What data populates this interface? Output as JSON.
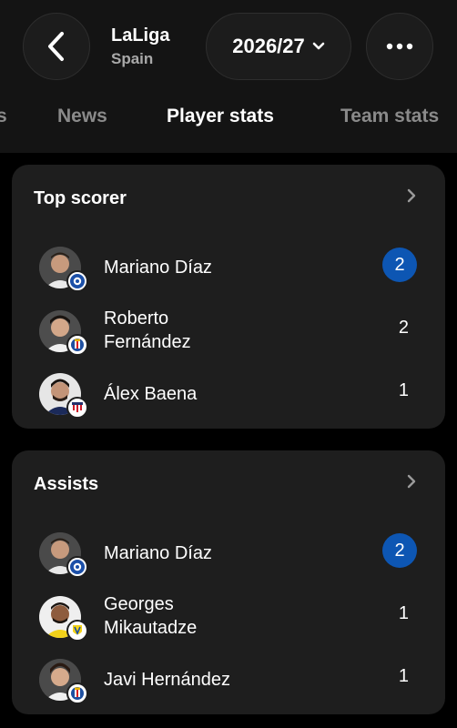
{
  "header": {
    "league_name": "LaLiga",
    "league_country": "Spain",
    "season": "2026/27"
  },
  "tabs": [
    {
      "label": "s"
    },
    {
      "label": "News"
    },
    {
      "label": "Player stats",
      "active": true
    },
    {
      "label": "Team stats"
    }
  ],
  "sections": [
    {
      "title": "Top scorer",
      "players": [
        {
          "name": "Mariano Díaz",
          "value": "2",
          "highlight": true,
          "team_badge": "alaves-badge"
        },
        {
          "name_line1": "Roberto",
          "name_line2": "Fernández",
          "value": "2",
          "team_badge": "espanyol-badge"
        },
        {
          "name": "Álex Baena",
          "value": "1",
          "team_badge": "atletico-badge"
        }
      ]
    },
    {
      "title": "Assists",
      "players": [
        {
          "name": "Mariano Díaz",
          "value": "2",
          "highlight": true,
          "team_badge": "alaves-badge"
        },
        {
          "name_line1": "Georges",
          "name_line2": "Mikautadze",
          "value": "1",
          "team_badge": "villarreal-badge"
        },
        {
          "name": "Javi Hernández",
          "value": "1",
          "team_badge": "espanyol-badge"
        }
      ]
    }
  ],
  "colors": {
    "background": "#000000",
    "header": "#141414",
    "card": "#1e1e1e",
    "highlight_pill": "#0d56b3",
    "inactive_tab": "#8a8a8a"
  }
}
